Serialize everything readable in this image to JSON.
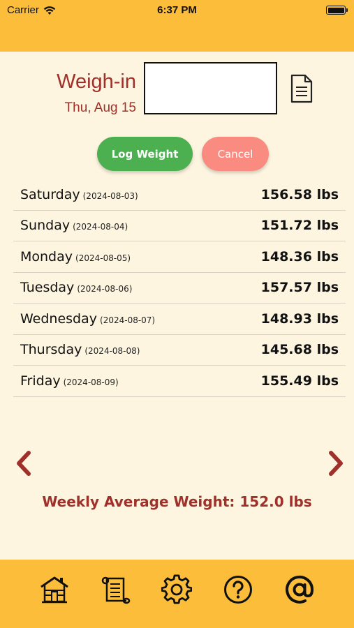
{
  "status_bar": {
    "carrier": "Carrier",
    "time": "6:37 PM"
  },
  "weighin": {
    "title": "Weigh-in",
    "date": "Thu, Aug 15",
    "input_value": "",
    "input_placeholder": ""
  },
  "buttons": {
    "log": "Log Weight",
    "cancel": "Cancel"
  },
  "entries": [
    {
      "day": "Saturday",
      "date": "(2024-08-03)",
      "weight": "156.58 lbs"
    },
    {
      "day": "Sunday",
      "date": "(2024-08-04)",
      "weight": "151.72 lbs"
    },
    {
      "day": "Monday",
      "date": "(2024-08-05)",
      "weight": "148.36 lbs"
    },
    {
      "day": "Tuesday",
      "date": "(2024-08-06)",
      "weight": "157.57 lbs"
    },
    {
      "day": "Wednesday",
      "date": "(2024-08-07)",
      "weight": "148.93 lbs"
    },
    {
      "day": "Thursday",
      "date": "(2024-08-08)",
      "weight": "145.68 lbs"
    },
    {
      "day": "Friday",
      "date": "(2024-08-09)",
      "weight": "155.49 lbs"
    }
  ],
  "weekly_average": "Weekly Average Weight: 152.0 lbs",
  "tabs": [
    "home-icon",
    "scroll-icon",
    "gear-icon",
    "help-icon",
    "at-icon"
  ],
  "colors": {
    "header": "#fbbd3a",
    "background": "#fdf5e0",
    "accent_red": "#a0302a",
    "log_green": "#4caf50",
    "cancel_pink": "#f98b80"
  }
}
